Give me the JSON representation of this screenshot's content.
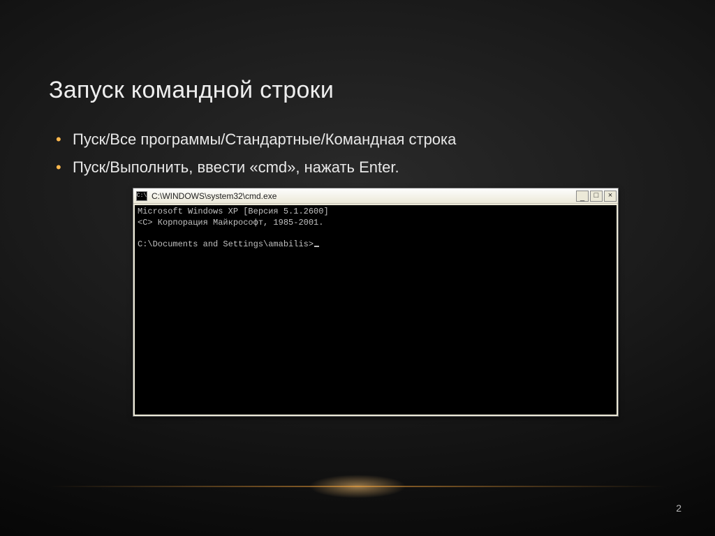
{
  "slide": {
    "title": "Запуск командной строки",
    "bullets": [
      "Пуск/Все программы/Стандартные/Командная строка",
      "Пуск/Выполнить, ввести «cmd», нажать Enter."
    ],
    "page_number": "2"
  },
  "cmd_window": {
    "icon_glyph": "C:\\",
    "title": "C:\\WINDOWS\\system32\\cmd.exe",
    "buttons": {
      "min": "_",
      "max": "□",
      "close": "×"
    },
    "line1": "Microsoft Windows XP [Версия 5.1.2600]",
    "line2": "<C> Корпорация Майкрософт, 1985-2001.",
    "prompt": "C:\\Documents and Settings\\amabilis>"
  }
}
